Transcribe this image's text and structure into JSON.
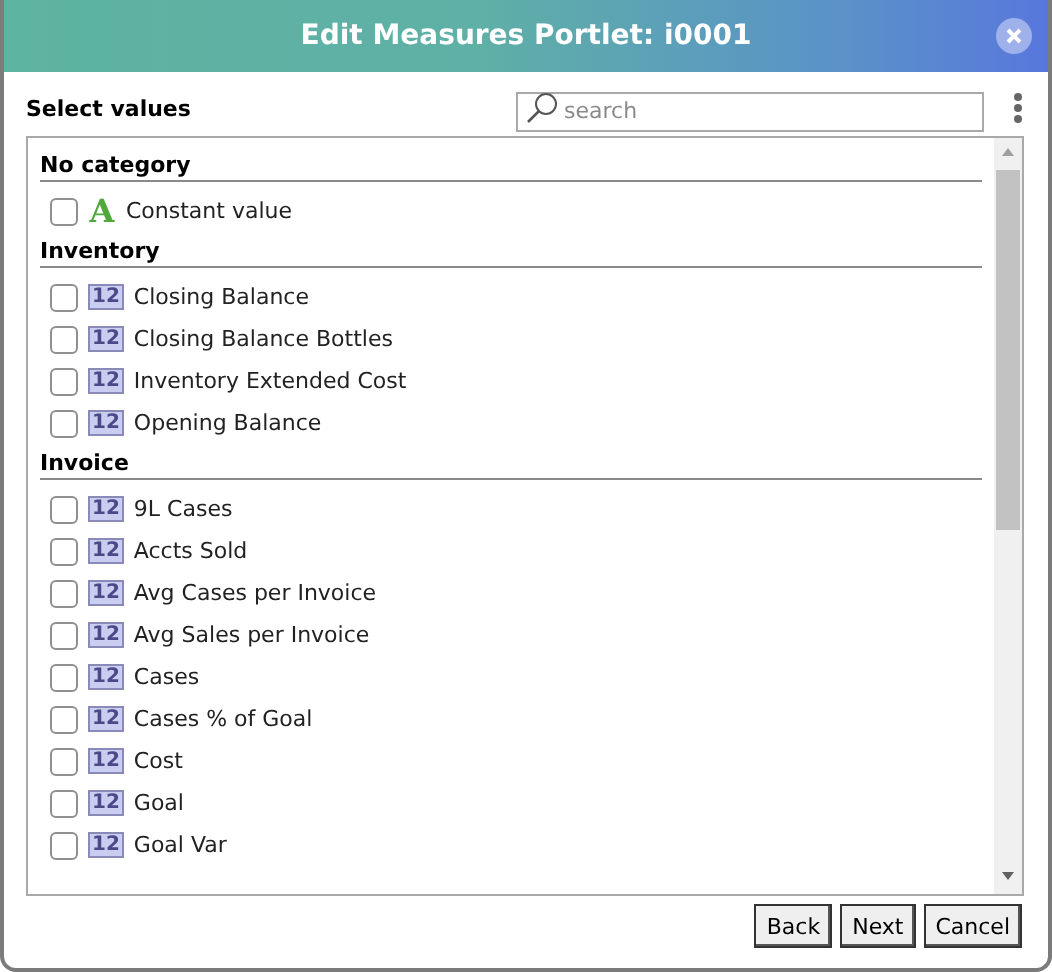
{
  "window": {
    "title": "Edit Measures Portlet: i0001"
  },
  "header": {
    "label": "Select values",
    "search": {
      "placeholder": "search"
    }
  },
  "categories": [
    {
      "name": "No category",
      "items": [
        {
          "label": "Constant value",
          "kind": "text",
          "icon": "A",
          "checked": false
        }
      ]
    },
    {
      "name": "Inventory",
      "items": [
        {
          "label": "Closing Balance",
          "kind": "number",
          "icon": "12",
          "checked": false
        },
        {
          "label": "Closing Balance Bottles",
          "kind": "number",
          "icon": "12",
          "checked": false
        },
        {
          "label": "Inventory Extended Cost",
          "kind": "number",
          "icon": "12",
          "checked": false
        },
        {
          "label": "Opening Balance",
          "kind": "number",
          "icon": "12",
          "checked": false
        }
      ]
    },
    {
      "name": "Invoice",
      "items": [
        {
          "label": "9L Cases",
          "kind": "number",
          "icon": "12",
          "checked": false
        },
        {
          "label": "Accts Sold",
          "kind": "number",
          "icon": "12",
          "checked": false
        },
        {
          "label": "Avg Cases per Invoice",
          "kind": "number",
          "icon": "12",
          "checked": false
        },
        {
          "label": "Avg Sales per Invoice",
          "kind": "number",
          "icon": "12",
          "checked": false
        },
        {
          "label": "Cases",
          "kind": "number",
          "icon": "12",
          "checked": false
        },
        {
          "label": "Cases % of Goal",
          "kind": "number",
          "icon": "12",
          "checked": false
        },
        {
          "label": "Cost",
          "kind": "number",
          "icon": "12",
          "checked": false
        },
        {
          "label": "Goal",
          "kind": "number",
          "icon": "12",
          "checked": false
        },
        {
          "label": "Goal Var",
          "kind": "number",
          "icon": "12",
          "checked": false
        }
      ]
    }
  ],
  "buttons": [
    "Back",
    "Next",
    "Cancel"
  ]
}
